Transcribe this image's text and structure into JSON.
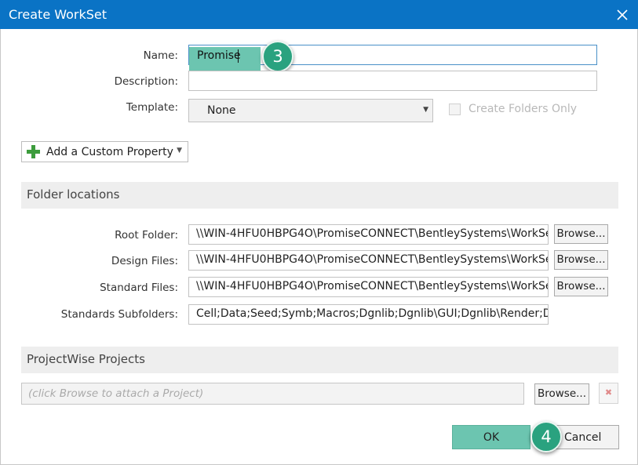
{
  "window": {
    "title": "Create WorkSet"
  },
  "form": {
    "name_label": "Name:",
    "name_value": "Promise",
    "description_label": "Description:",
    "description_value": "",
    "template_label": "Template:",
    "template_value": "None",
    "create_folders_only_label": "Create Folders Only",
    "create_folders_only_checked": false,
    "add_property_label": "Add a Custom Property"
  },
  "folders": {
    "section_title": "Folder locations",
    "rows": [
      {
        "label": "Root Folder:",
        "value": "\\\\WIN-4HFU0HBPG4O\\PromiseCONNECT\\BentleySystems\\WorkSe",
        "button": "Browse..."
      },
      {
        "label": "Design Files:",
        "value": "\\\\WIN-4HFU0HBPG4O\\PromiseCONNECT\\BentleySystems\\WorkSe",
        "button": "Browse..."
      },
      {
        "label": "Standard Files:",
        "value": "\\\\WIN-4HFU0HBPG4O\\PromiseCONNECT\\BentleySystems\\WorkSe",
        "button": "Browse..."
      }
    ],
    "subfolders_label": "Standards Subfolders:",
    "subfolders_value": "Cell;Data;Seed;Symb;Macros;Dgnlib;Dgnlib\\GUI;Dgnlib\\Render;Dgn"
  },
  "projectwise": {
    "section_title": "ProjectWise Projects",
    "placeholder": "(click Browse to attach a Project)",
    "browse_label": "Browse...",
    "remove_symbol": "✖"
  },
  "footer": {
    "ok_label": "OK",
    "cancel_label": "Cancel"
  },
  "callouts": {
    "step_name": "3",
    "step_ok": "4"
  },
  "colors": {
    "titlebar": "#0a73c5",
    "highlight": "#6cc5b0",
    "badge": "#2aa27f",
    "plus_icon": "#3d9c3d"
  }
}
